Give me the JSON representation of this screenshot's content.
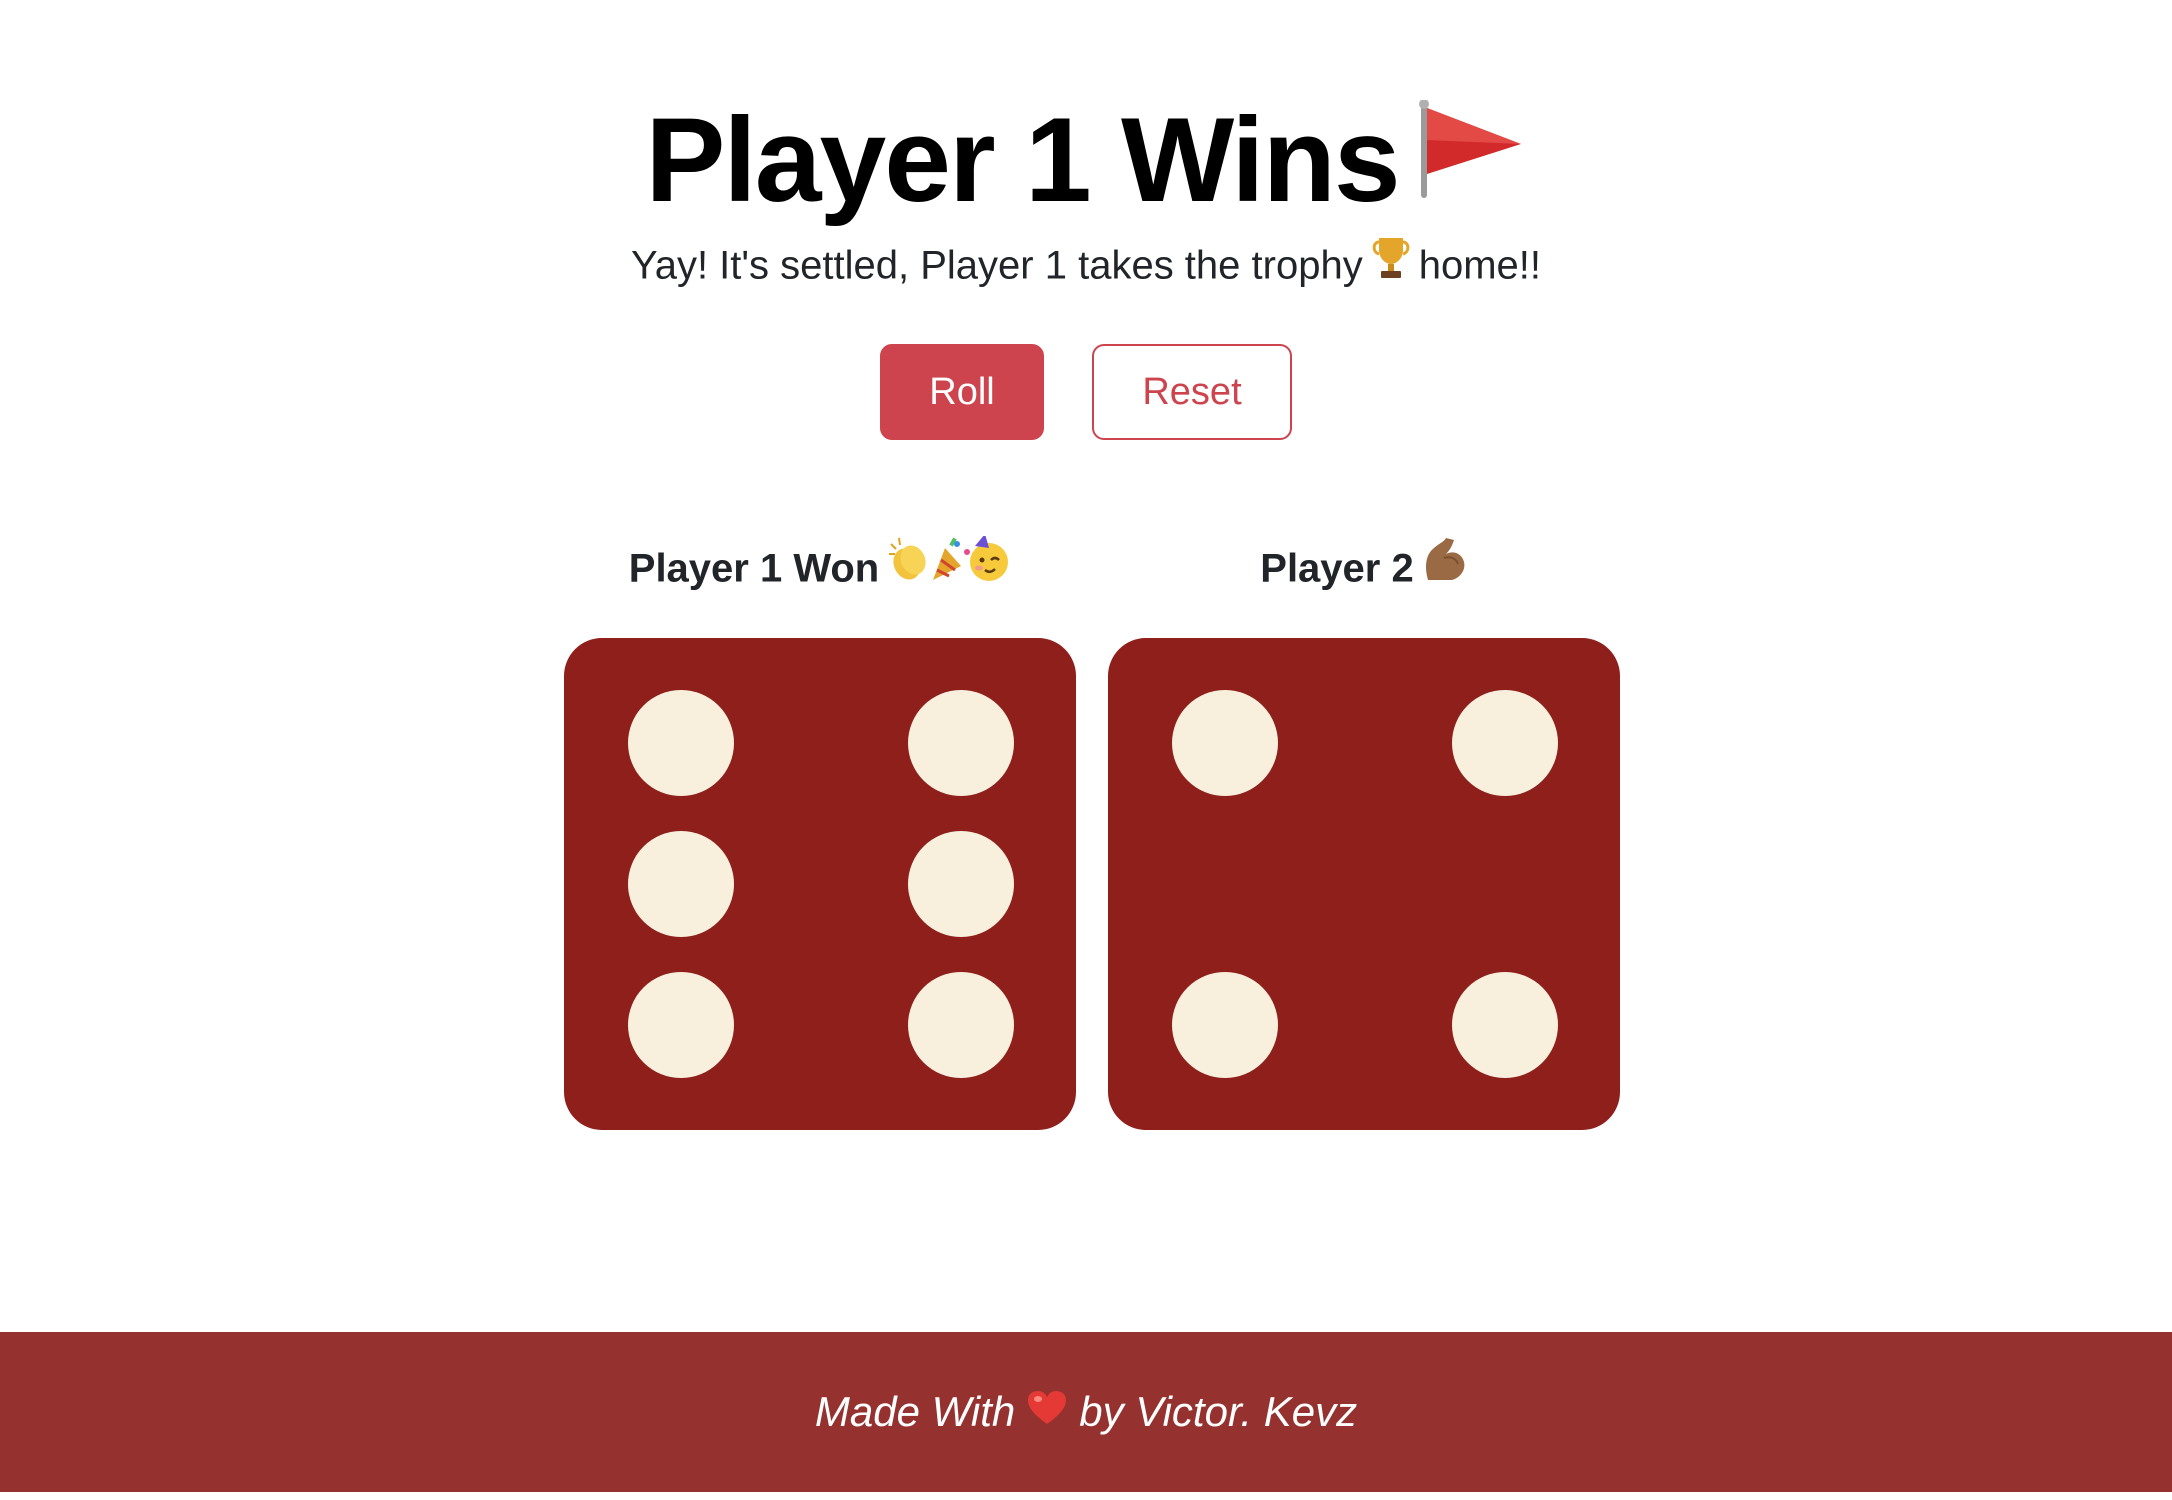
{
  "header": {
    "title": "Player 1 Wins",
    "title_icon": "red-flag-icon",
    "subtitle_before": "Yay! It's settled, Player 1 takes the trophy",
    "subtitle_icon": "trophy-icon",
    "subtitle_after": "home!!"
  },
  "controls": {
    "roll_label": "Roll",
    "reset_label": "Reset"
  },
  "players": [
    {
      "label": "Player 1 Won",
      "emoji_icons": [
        "clapping-hands-icon",
        "party-popper-icon",
        "partying-face-icon"
      ],
      "die_value": 6
    },
    {
      "label": "Player 2",
      "emoji_icons": [
        "flexed-biceps-icon"
      ],
      "die_value": 4
    }
  ],
  "footer": {
    "text_before": "Made With",
    "icon": "heart-icon",
    "text_after": "by Victor. Kevz"
  },
  "colors": {
    "accent": "#cd444e",
    "die_face": "#8e1f1b",
    "pip": "#f8f0dc",
    "footer_bg": "#953230"
  }
}
